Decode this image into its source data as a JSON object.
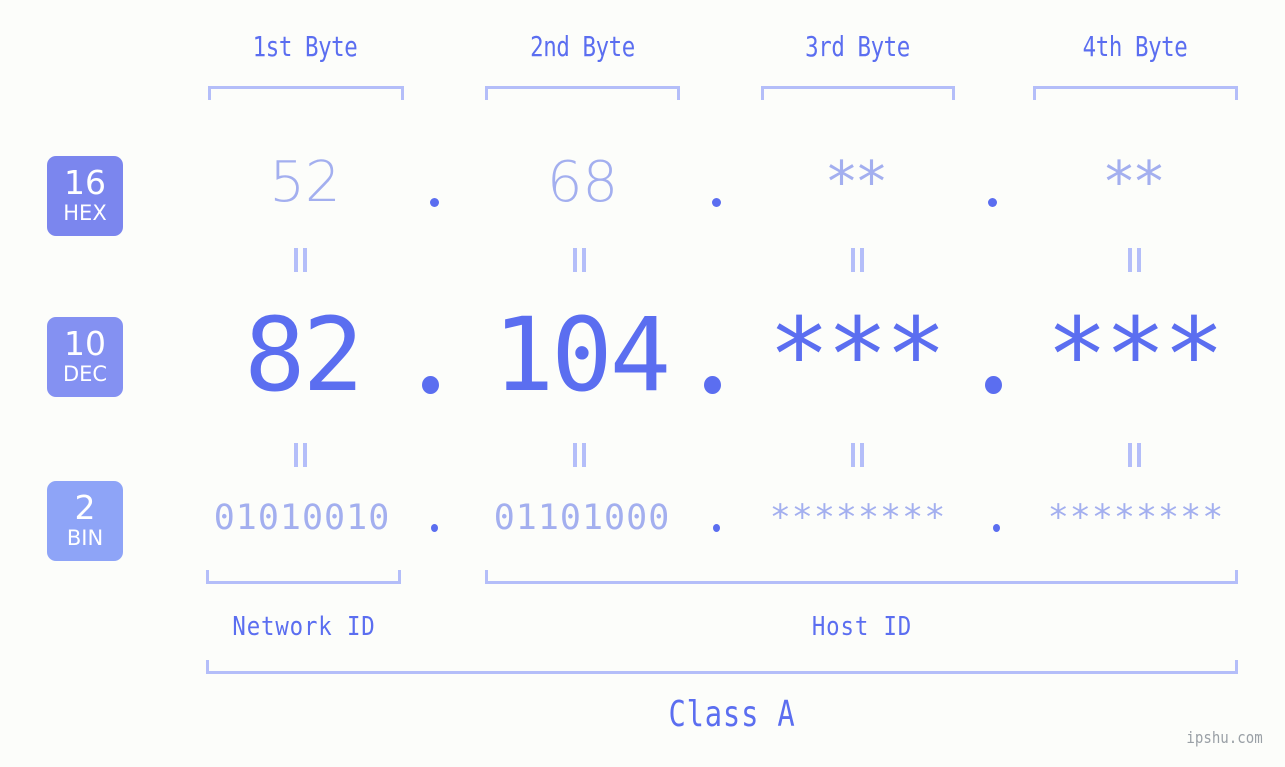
{
  "meta": {
    "background_color": "#fcfdfa",
    "accent_strong": "#5b6ef0",
    "accent_light": "#a3afef",
    "accent_bracket": "#b4bef9",
    "watermark": "ipshu.com"
  },
  "byte_headers": [
    {
      "label": "1st Byte"
    },
    {
      "label": "2nd Byte"
    },
    {
      "label": "3rd Byte"
    },
    {
      "label": "4th Byte"
    }
  ],
  "bases": [
    {
      "number": "16",
      "name": "HEX",
      "color": "#7b86ee"
    },
    {
      "number": "10",
      "name": "DEC",
      "color": "#8491f2"
    },
    {
      "number": "2",
      "name": "BIN",
      "color": "#8ea4f7"
    }
  ],
  "rows": {
    "hex": {
      "values": [
        "52",
        "68",
        "**",
        "**"
      ],
      "separator": "."
    },
    "dec": {
      "values": [
        "82",
        "104",
        "***",
        "***"
      ],
      "separator": "."
    },
    "bin": {
      "values": [
        "01010010",
        "01101000",
        "********",
        "********"
      ],
      "separator": "."
    }
  },
  "equality_symbol": "=",
  "segments": {
    "network_id": "Network ID",
    "host_id": "Host ID"
  },
  "class_label": "Class A"
}
